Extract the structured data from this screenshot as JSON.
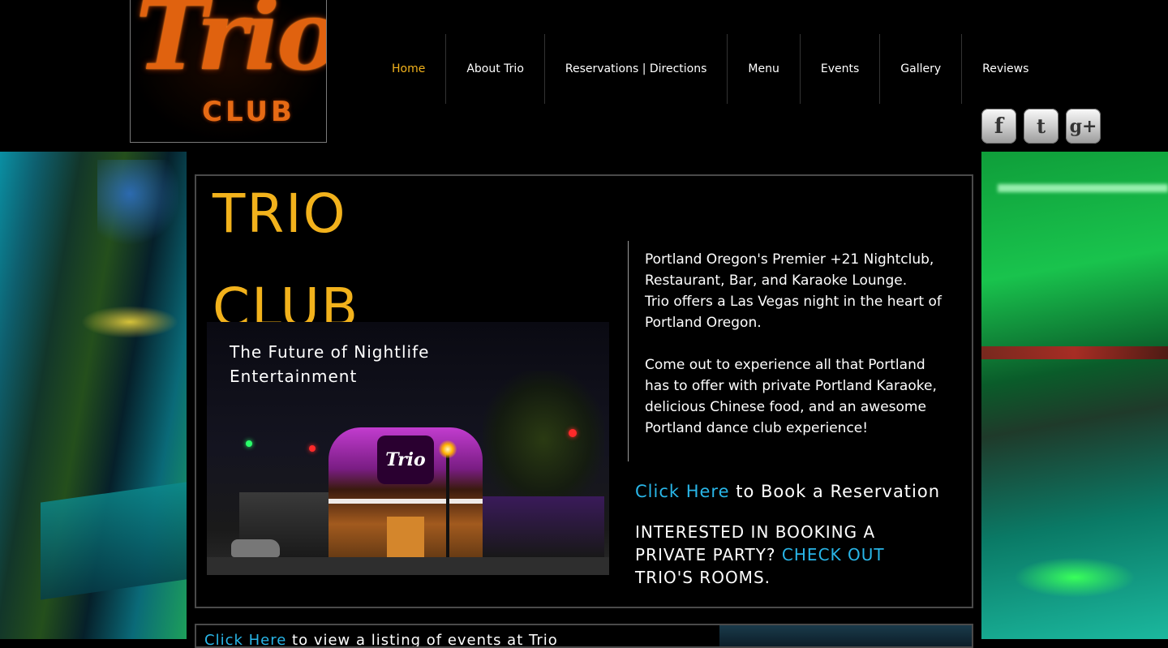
{
  "header": {
    "logo": {
      "script": "Trio",
      "club": "CLUB"
    },
    "nav": [
      {
        "label": "Home",
        "active": true
      },
      {
        "label": "About Trio"
      },
      {
        "label": "Reservations | Directions"
      },
      {
        "label": "Menu"
      },
      {
        "label": "Events"
      },
      {
        "label": "Gallery"
      },
      {
        "label": "Reviews"
      }
    ],
    "social": [
      {
        "icon": "facebook-icon",
        "glyph": "f"
      },
      {
        "icon": "twitter-icon",
        "glyph": "t"
      },
      {
        "icon": "google-plus-icon",
        "glyph": "g+"
      }
    ]
  },
  "main": {
    "title_line1": "TRIO",
    "title_line2": "CLUB",
    "tagline_line1": "The Future of Nightlife",
    "tagline_line2": "Entertainment",
    "photo_sign": "Trio",
    "description": {
      "p1_line1": "Portland Oregon's Premier +21 Nightclub,",
      "p1_line2": "Restaurant, Bar, and Karaoke Lounge.",
      "p1_line3": "Trio offers a Las Vegas night in the heart of",
      "p1_line4": "Portland Oregon.",
      "p2_line1": "Come out to experience all that Portland",
      "p2_line2": "has to offer with private Portland Karaoke,",
      "p2_line3": "delicious Chinese food, and an awesome",
      "p2_line4": "Portland dance club experience!"
    },
    "book": {
      "link": "Click Here",
      "rest": " to Book a Reservation"
    },
    "party": {
      "text": "Interested in booking a private party? ",
      "link": "Check out",
      "rest": " Trio's rooms."
    }
  },
  "panel2": {
    "link": "Click Here",
    "rest": " to view a listing of events at Trio"
  },
  "colors": {
    "accent": "#f2b21c",
    "link": "#29b6e8",
    "logo": "#e0620f"
  }
}
